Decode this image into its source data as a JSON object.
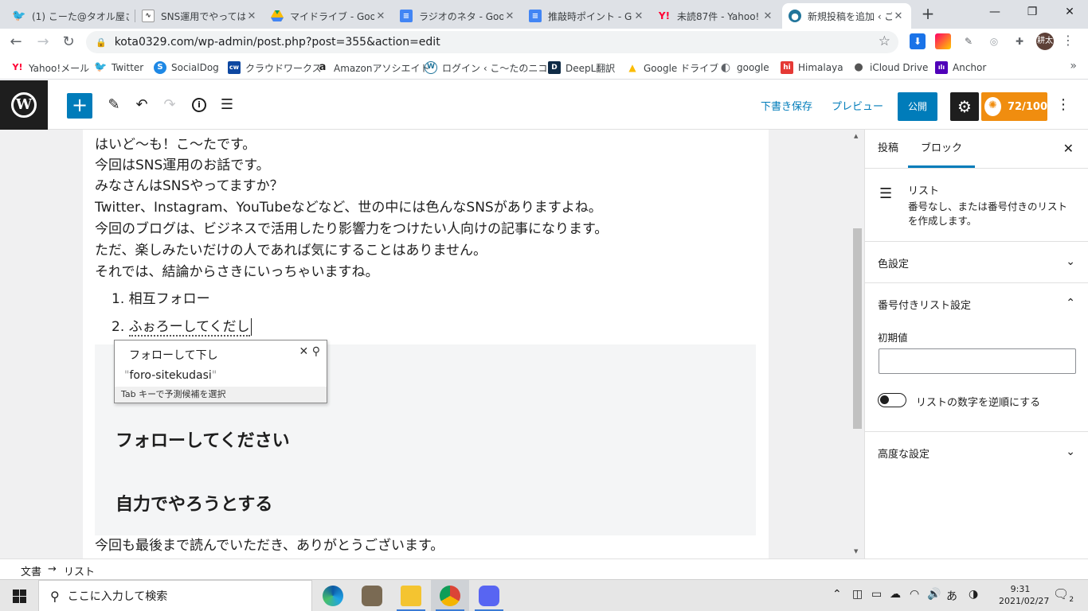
{
  "browser": {
    "tabs": [
      {
        "label": "(1) こーた@タオル屋さ",
        "icon": "twitter-icon",
        "color": "#1da1f2"
      },
      {
        "label": "SNS運用でやってはい",
        "icon": "activity-icon",
        "color": "#333333"
      },
      {
        "label": "マイドライブ - Google",
        "icon": "google-drive-icon",
        "color": "#0f9d58"
      },
      {
        "label": "ラジオのネタ - Goog",
        "icon": "google-docs-icon",
        "color": "#4285f4"
      },
      {
        "label": "推敲時ポイント - Go",
        "icon": "google-docs-icon",
        "color": "#4285f4"
      },
      {
        "label": "未読87件 - Yahoo!",
        "icon": "yahoo-icon",
        "color": "#ff0033"
      },
      {
        "label": "新規投稿を追加 ‹ ご",
        "icon": "wordpress-icon",
        "color": "#21759b"
      }
    ],
    "url": "kota0329.com/wp-admin/post.php?post=355&action=edit",
    "profile_initials": "耕太",
    "bookmarks": [
      {
        "label": "Yahoo!メール",
        "icon": "yahoo-icon",
        "color": "#ff0033",
        "glyph": "Y!"
      },
      {
        "label": "Twitter",
        "icon": "twitter-icon",
        "color": "#1da1f2",
        "glyph": "t"
      },
      {
        "label": "SocialDog",
        "icon": "socialdog-icon",
        "color": "#1e88e5",
        "glyph": "S"
      },
      {
        "label": "クラウドワークス",
        "icon": "crowdworks-icon",
        "color": "#0d47a1",
        "glyph": "cw"
      },
      {
        "label": "Amazonアソシエイト",
        "icon": "amazon-icon",
        "color": "#222222",
        "glyph": "a"
      },
      {
        "label": "ログイン ‹ こ〜たのニコ...",
        "icon": "wordpress-icon",
        "color": "#21759b",
        "glyph": "W"
      },
      {
        "label": "DeepL翻訳",
        "icon": "deepl-icon",
        "color": "#0f2b46",
        "glyph": "D"
      },
      {
        "label": "Google ドライブ",
        "icon": "google-drive-icon",
        "color": "#0f9d58",
        "glyph": "▲"
      },
      {
        "label": "google",
        "icon": "globe-icon",
        "color": "#5f6368",
        "glyph": "◐"
      },
      {
        "label": "Himalaya",
        "icon": "himalaya-icon",
        "color": "#e53935",
        "glyph": "hi"
      },
      {
        "label": "iCloud Drive",
        "icon": "apple-icon",
        "color": "#555555",
        "glyph": ""
      },
      {
        "label": "Anchor",
        "icon": "anchor-icon",
        "color": "#5000b9",
        "glyph": "ılı"
      }
    ]
  },
  "wp": {
    "save_draft": "下書き保存",
    "preview": "プレビュー",
    "publish": "公開",
    "score": "72/100",
    "paragraphs": [
      "はいど〜も！こ〜たです。",
      "今回はSNS運用のお話です。",
      "みなさんはSNSやってますか？",
      "Twitter、Instagram、YouTubeなどなど、世の中には色んなSNSがありますよね。",
      "今回のブログは、ビジネスで活用したり影響力をつけたい人向けの記事になります。",
      "ただ、楽しみたいだけの人であれば気にすることはありません。",
      "それでは、結論からさきにいっちゃいますね。"
    ],
    "list_items": [
      {
        "num": "1.",
        "text": "相互フォロー"
      },
      {
        "num": "2.",
        "text": "ふぉろーしてくだし"
      }
    ],
    "headings": [
      "フォローしてください",
      "自力でやろうとする"
    ],
    "closing": "今回も最後まで読んでいただき、ありがとうございます。",
    "ime": {
      "candidate": "フォローして下し",
      "romaji": "foro-sitekudasi",
      "hint": "Tab キーで予測候補を選択"
    },
    "sidebar": {
      "tab_post": "投稿",
      "tab_block": "ブロック",
      "block_name": "リスト",
      "block_desc": "番号なし、または番号付きのリストを作成します。",
      "color_settings": "色設定",
      "numbered_list_settings": "番号付きリスト設定",
      "start_value_label": "初期値",
      "start_value": "",
      "reverse_label": "リストの数字を逆順にする",
      "reverse_on": false,
      "advanced": "高度な設定"
    },
    "breadcrumb": [
      "文書",
      "リスト"
    ],
    "breadcrumb_sep": "→"
  },
  "taskbar": {
    "search_placeholder": "ここに入力して検索",
    "ime_mode": "あ",
    "time": "9:31",
    "date": "2021/02/27",
    "notifications": "2"
  },
  "colors": {
    "wp_blue": "#007cba",
    "score_orange": "#f08d0f",
    "wp_dark": "#1e1e1e"
  }
}
